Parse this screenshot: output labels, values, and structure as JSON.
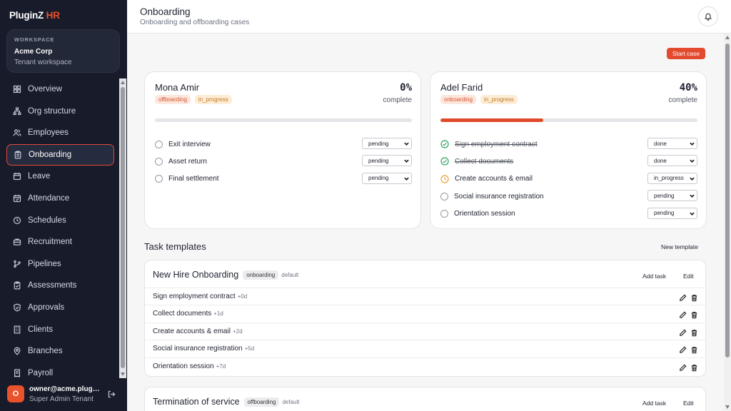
{
  "brand": {
    "name": "PluginZ",
    "suffix": "HR"
  },
  "workspace": {
    "label": "WORKSPACE",
    "name": "Acme Corp",
    "sub": "Tenant workspace"
  },
  "nav": [
    {
      "label": "Overview",
      "icon": "grid-icon"
    },
    {
      "label": "Org structure",
      "icon": "org-icon"
    },
    {
      "label": "Employees",
      "icon": "users-icon"
    },
    {
      "label": "Onboarding",
      "icon": "clipboard-icon",
      "active": true
    },
    {
      "label": "Leave",
      "icon": "calendar-icon"
    },
    {
      "label": "Attendance",
      "icon": "calendar-check-icon"
    },
    {
      "label": "Schedules",
      "icon": "clock-icon"
    },
    {
      "label": "Recruitment",
      "icon": "briefcase-icon"
    },
    {
      "label": "Pipelines",
      "icon": "branch-icon"
    },
    {
      "label": "Assessments",
      "icon": "clipboard-check-icon"
    },
    {
      "label": "Approvals",
      "icon": "shield-check-icon"
    },
    {
      "label": "Clients",
      "icon": "building-icon"
    },
    {
      "label": "Branches",
      "icon": "map-pin-icon"
    },
    {
      "label": "Payroll",
      "icon": "receipt-icon"
    }
  ],
  "user": {
    "initial": "O",
    "email": "owner@acme.pluginz.app",
    "role": "Super Admin Tenant"
  },
  "header": {
    "title": "Onboarding",
    "subtitle": "Onboarding and offboarding cases"
  },
  "actions": {
    "start_case": "Start case"
  },
  "cases": [
    {
      "name": "Mona Amir",
      "type": "offboarding",
      "status": "in_progress",
      "percent": "0%",
      "percent_label": "complete",
      "progress": 0,
      "tasks": [
        {
          "label": "Exit interview",
          "state": "pending"
        },
        {
          "label": "Asset return",
          "state": "pending"
        },
        {
          "label": "Final settlement",
          "state": "pending"
        }
      ]
    },
    {
      "name": "Adel Farid",
      "type": "onboarding",
      "status": "in_progress",
      "percent": "40%",
      "percent_label": "complete",
      "progress": 0.4,
      "tasks": [
        {
          "label": "Sign employment contract",
          "state": "done"
        },
        {
          "label": "Collect documents",
          "state": "done"
        },
        {
          "label": "Create accounts & email",
          "state": "in_progress"
        },
        {
          "label": "Social insurance registration",
          "state": "pending"
        },
        {
          "label": "Orientation session",
          "state": "pending"
        }
      ]
    }
  ],
  "templates_section": {
    "title": "Task templates",
    "new_label": "New template"
  },
  "templates": [
    {
      "name": "New Hire Onboarding",
      "type": "onboarding",
      "default_label": "default",
      "add_label": "Add task",
      "edit_label": "Edit",
      "rows": [
        {
          "label": "Sign employment contract",
          "offset": "+0d"
        },
        {
          "label": "Collect documents",
          "offset": "+1d"
        },
        {
          "label": "Create accounts & email",
          "offset": "+2d"
        },
        {
          "label": "Social insurance registration",
          "offset": "+5d"
        },
        {
          "label": "Orientation session",
          "offset": "+7d"
        }
      ]
    },
    {
      "name": "Termination of service",
      "type": "offboarding",
      "default_label": "default",
      "add_label": "Add task",
      "edit_label": "Edit",
      "rows": []
    }
  ],
  "colors": {
    "accent": "#e34a2e",
    "sidebar": "#171b2a",
    "done": "#2fa565",
    "progress": "#e9a23b"
  }
}
